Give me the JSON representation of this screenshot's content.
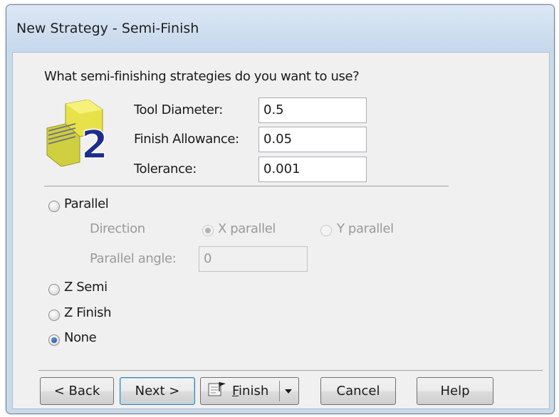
{
  "window": {
    "title": "New Strategy - Semi-Finish"
  },
  "prompt": "What semi-finishing strategies do you want to use?",
  "fields": {
    "tool_diameter": {
      "label": "Tool Diameter:",
      "value": "0.5"
    },
    "finish_allowance": {
      "label": "Finish Allowance:",
      "value": "0.05"
    },
    "tolerance": {
      "label": "Tolerance:",
      "value": "0.001"
    }
  },
  "strategies": {
    "parallel": {
      "label": "Parallel",
      "selected": false
    },
    "z_semi": {
      "label": "Z Semi",
      "selected": false
    },
    "z_finish": {
      "label": "Z Finish",
      "selected": false
    },
    "none": {
      "label": "None",
      "selected": true
    }
  },
  "parallel_options": {
    "direction_label": "Direction",
    "x_parallel": {
      "label": "X parallel",
      "selected": true
    },
    "y_parallel": {
      "label": "Y parallel",
      "selected": false
    },
    "angle_label": "Parallel angle:",
    "angle_value": "0"
  },
  "buttons": {
    "back": "< Back",
    "next": "Next >",
    "finish_prefix": "",
    "finish_mnemonic": "F",
    "finish_rest": "inish",
    "cancel": "Cancel",
    "help": "Help"
  },
  "icons": {
    "step_icon": "semi-finish-step-2-icon",
    "finish_icon": "finish-flag-icon",
    "dropdown_icon": "dropdown-arrow-icon"
  }
}
